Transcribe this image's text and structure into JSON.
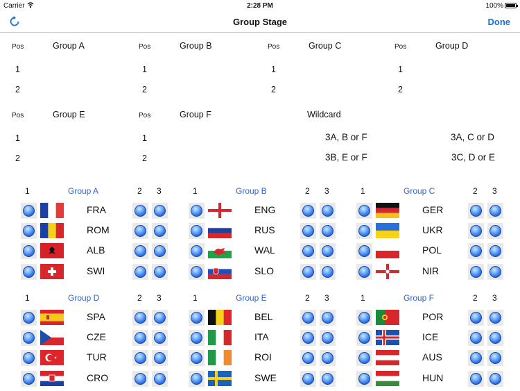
{
  "status_bar": {
    "carrier": "Carrier",
    "time": "2:28 PM",
    "battery": "100%"
  },
  "nav": {
    "title": "Group Stage",
    "done_label": "Done"
  },
  "table": {
    "pos_label": "Pos",
    "group_a": "Group A",
    "group_b": "Group B",
    "group_c": "Group C",
    "group_d": "Group D",
    "group_e": "Group E",
    "group_f": "Group F",
    "wildcard": "Wildcard",
    "rank1": "1",
    "rank2": "2",
    "wild_1": "3A, B or F",
    "wild_2": "3B, E or F",
    "wild_3": "3A, C or D",
    "wild_4": "3C, D or E"
  },
  "grid": {
    "col1": "1",
    "col2": "2",
    "col3": "3",
    "groups": [
      {
        "title": "Group A",
        "teams": [
          "FRA",
          "ROM",
          "ALB",
          "SWI"
        ]
      },
      {
        "title": "Group B",
        "teams": [
          "ENG",
          "RUS",
          "WAL",
          "SLO"
        ]
      },
      {
        "title": "Group C",
        "teams": [
          "GER",
          "UKR",
          "POL",
          "NIR"
        ]
      },
      {
        "title": "Group D",
        "teams": [
          "SPA",
          "CZE",
          "TUR",
          "CRO"
        ]
      },
      {
        "title": "Group E",
        "teams": [
          "BEL",
          "ITA",
          "ROI",
          "SWE"
        ]
      },
      {
        "title": "Group F",
        "teams": [
          "POR",
          "ICE",
          "AUS",
          "HUN"
        ]
      }
    ]
  },
  "colors": {
    "accent": "#1a72d9",
    "group_title": "#3366cc",
    "radio": "#2c6fe0"
  }
}
